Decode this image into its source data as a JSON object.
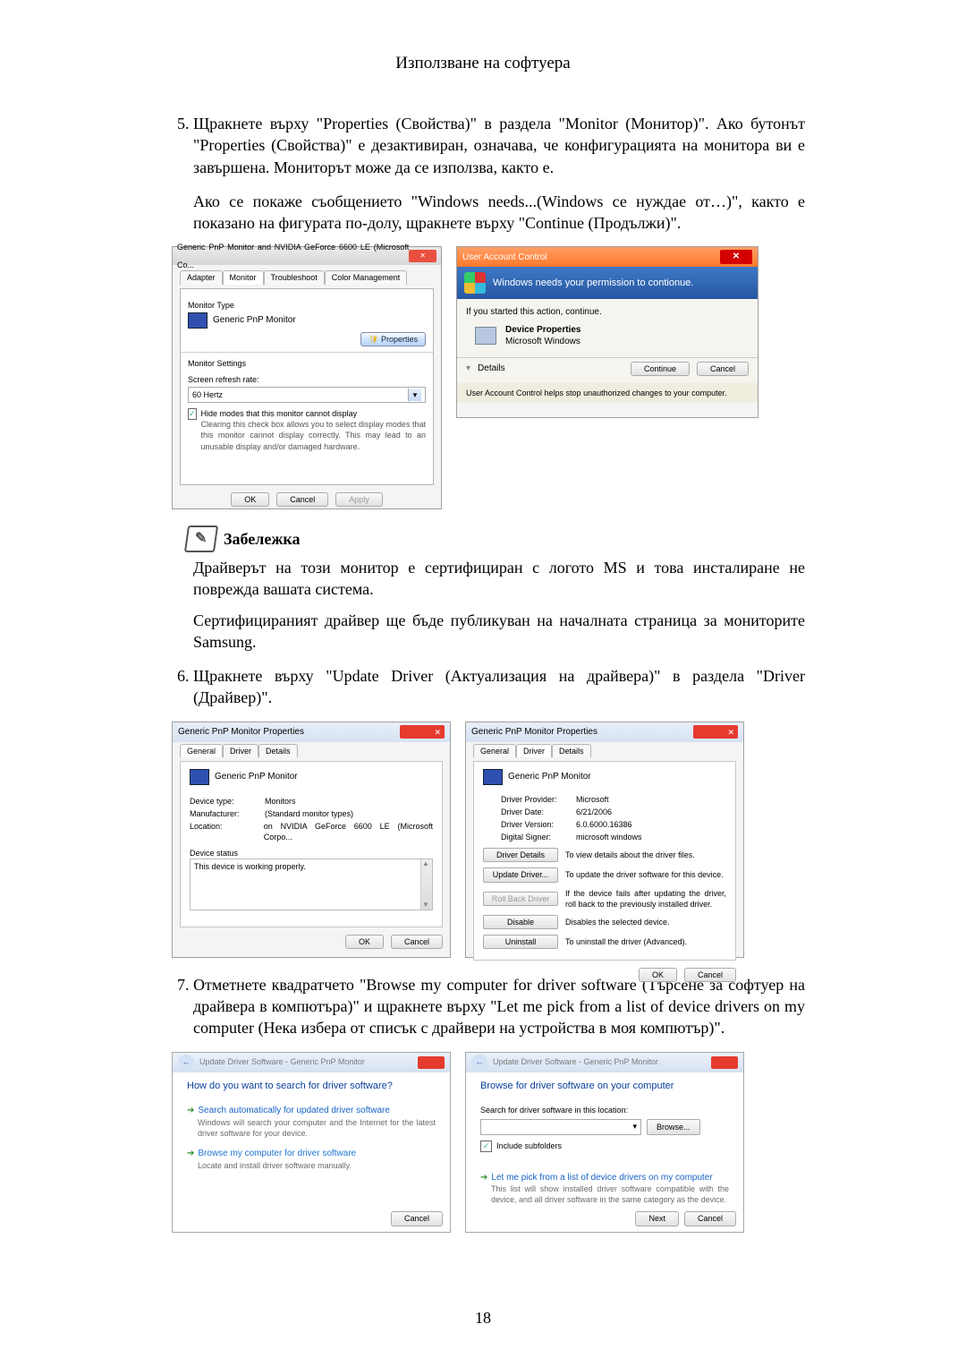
{
  "header_title": "Използване на софтуера",
  "page_number": "18",
  "step5": {
    "index": "5.",
    "p1": "Щракнете върху \"Properties (Свойства)\" в раздела \"Monitor (Монитор)\". Ако бутонът \"Properties (Свойства)\" е дезактивиран, означава, че конфигурацията на монитора ви е завършена. Мониторът може да се използва, както е.",
    "p2": "Ако се покаже съобщението \"Windows needs...(Windows се нуждае от…)\", както е показано на фигурата по-долу, щракнете върху \"Continue (Продължи)\"."
  },
  "shot1_left": {
    "title": "Generic PnP Monitor and NVIDIA GeForce 6600 LE (Microsoft Co...",
    "tabs": [
      "Adapter",
      "Monitor",
      "Troubleshoot",
      "Color Management"
    ],
    "monitor_type_label": "Monitor Type",
    "monitor_type_value": "Generic PnP Monitor",
    "properties_btn": "Properties",
    "settings_label": "Monitor Settings",
    "refresh_label": "Screen refresh rate:",
    "refresh_value": "60 Hertz",
    "cbx_label": "Hide modes that this monitor cannot display",
    "cbx_desc": "Clearing this check box allows you to select display modes that this monitor cannot display correctly. This may lead to an unusable display and/or damaged hardware.",
    "ok": "OK",
    "cancel": "Cancel",
    "apply": "Apply"
  },
  "shot1_right": {
    "title": "User Account Control",
    "perm": "Windows needs your permission to contionue.",
    "action": "If you started this action, continue.",
    "prop_title": "Device Properties",
    "prop_pub": "Microsoft Windows",
    "details": "Details",
    "details_icon": "▾",
    "continue": "Continue",
    "cancel": "Cancel",
    "foot": "User Account Control helps stop unauthorized changes to your computer."
  },
  "note": {
    "heading": "Забележка",
    "p1": "Драйверът на този монитор е сертифициран с логото MS и това инсталиране не поврежда вашата система.",
    "p2": "Сертифицираният драйвер ще бъде публикуван на началната страница за мониторите Samsung."
  },
  "step6": {
    "index": "6.",
    "p": "Щракнете върху \"Update Driver (Актуализация на драйвера)\" в раздела \"Driver (Драйвер)\"."
  },
  "shot2_left": {
    "title": "Generic PnP Monitor Properties",
    "tabs": [
      "General",
      "Driver",
      "Details"
    ],
    "device": "Generic PnP Monitor",
    "rows": {
      "dtype_k": "Device type:",
      "dtype_v": "Monitors",
      "manu_k": "Manufacturer:",
      "manu_v": "(Standard monitor types)",
      "loc_k": "Location:",
      "loc_v": "on NVIDIA GeForce 6600 LE (Microsoft Corpo..."
    },
    "status_label": "Device status",
    "status_text": "This device is working properly.",
    "ok": "OK",
    "cancel": "Cancel"
  },
  "shot2_right": {
    "title": "Generic PnP Monitor Properties",
    "tabs": [
      "General",
      "Driver",
      "Details"
    ],
    "device": "Generic PnP Monitor",
    "rows": {
      "prov_k": "Driver Provider:",
      "prov_v": "Microsoft",
      "date_k": "Driver Date:",
      "date_v": "6/21/2006",
      "ver_k": "Driver Version:",
      "ver_v": "6.0.6000.16386",
      "sig_k": "Digital Signer:",
      "sig_v": "microsoft windows"
    },
    "btns": {
      "details": {
        "label": "Driver Details",
        "desc": "To view details about the driver files."
      },
      "update": {
        "label": "Update Driver...",
        "desc": "To update the driver software for this device."
      },
      "rollback": {
        "label": "Roll Back Driver",
        "desc": "If the device fails after updating the driver, roll back to the previously installed driver."
      },
      "disable": {
        "label": "Disable",
        "desc": "Disables the selected device."
      },
      "uninstall": {
        "label": "Uninstall",
        "desc": "To uninstall the driver (Advanced)."
      }
    },
    "ok": "OK",
    "cancel": "Cancel"
  },
  "step7": {
    "index": "7.",
    "p": "Отметнете квадратчето \"Browse my computer for driver software (Търсене за софтуер на драйвера в компютъра)\" и щракнете върху \"Let me pick from a list of device drivers on my computer (Нека избера от списък с драйвери на устройства в моя компютър)\"."
  },
  "shot3_left": {
    "crumb": "Update Driver Software - Generic PnP Monitor",
    "h1": "How do you want to search for driver software?",
    "opt1_t": "Search automatically for updated driver software",
    "opt1_d": "Windows will search your computer and the Internet for the latest driver software for your device.",
    "opt2_t": "Browse my computer for driver software",
    "opt2_d": "Locate and install driver software manually.",
    "cancel": "Cancel"
  },
  "shot3_right": {
    "crumb": "Update Driver Software - Generic PnP Monitor",
    "h1": "Browse for driver software on your computer",
    "loc_label": "Search for driver software in this location:",
    "loc_value": "",
    "browse": "Browse...",
    "include": "Include subfolders",
    "opt_t": "Let me pick from a list of device drivers on my computer",
    "opt_d": "This list will show installed driver software compatible with the device, and all driver software in the same category as the device.",
    "next": "Next",
    "cancel": "Cancel"
  }
}
